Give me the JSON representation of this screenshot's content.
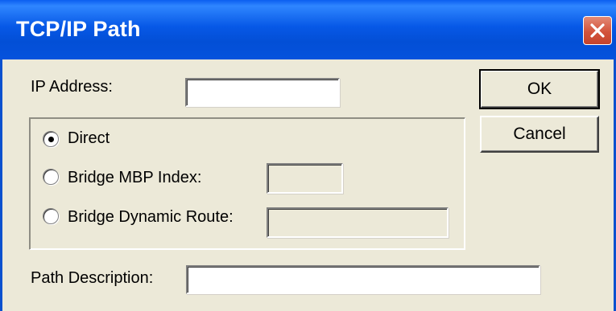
{
  "window": {
    "title": "TCP/IP Path"
  },
  "form": {
    "ip_address_label": "IP Address:",
    "ip_address_value": "",
    "path_description_label": "Path Description:",
    "path_description_value": ""
  },
  "route_options": {
    "direct_label": "Direct",
    "bridge_mbp_label": "Bridge MBP Index:",
    "bridge_mbp_value": "",
    "bridge_dynamic_label": "Bridge Dynamic Route:",
    "bridge_dynamic_value": "",
    "selected": "Direct"
  },
  "buttons": {
    "ok_label": "OK",
    "cancel_label": "Cancel"
  },
  "colors": {
    "title_bar": "#0758e6",
    "dialog_face": "#ece9d8",
    "close_button": "#d3533b"
  }
}
